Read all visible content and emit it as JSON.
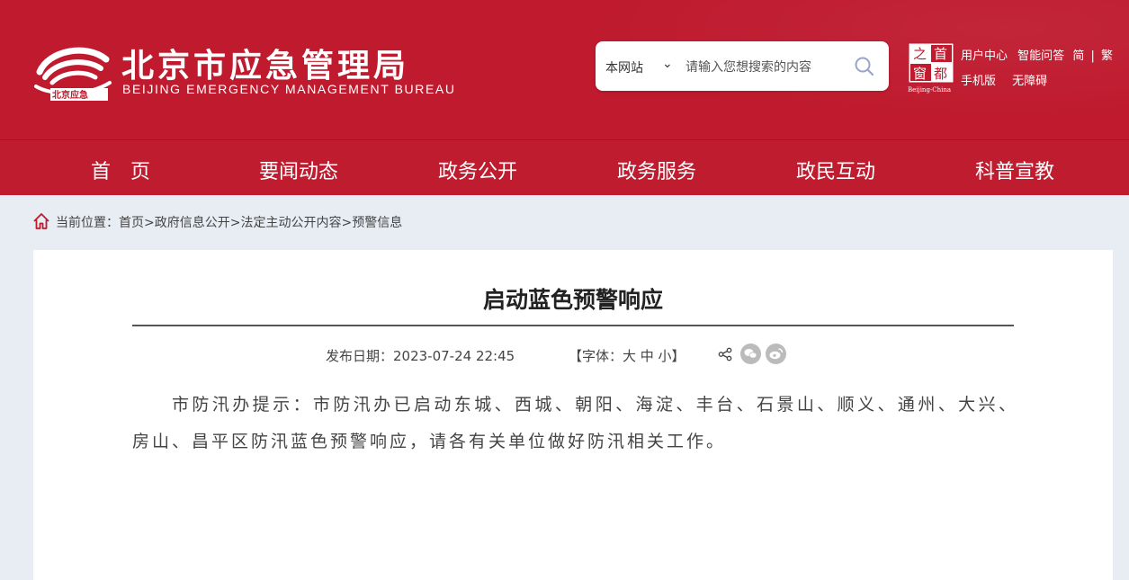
{
  "header": {
    "site_title": "北京市应急管理局",
    "site_title_en": "BEIJING EMERGENCY MANAGEMENT BUREAU",
    "logo_mark_text": "北京应急",
    "search": {
      "scope": "本网站",
      "placeholder": "请输入您想搜索的内容"
    },
    "capital_badge": {
      "chars": [
        "首",
        "都",
        "之",
        "窗"
      ],
      "caption": "Beijing-China"
    },
    "links_row1": [
      "用户中心",
      "智能问答",
      "简",
      "|",
      "繁"
    ],
    "links_row2": [
      "手机版",
      "无障碍"
    ]
  },
  "nav": {
    "items": [
      "首　页",
      "要闻动态",
      "政务公开",
      "政务服务",
      "政民互动",
      "科普宣教"
    ]
  },
  "breadcrumb": {
    "text": "当前位置：首页>政府信息公开>法定主动公开内容>预警信息"
  },
  "article": {
    "title": "启动蓝色预警响应",
    "date_label": "发布日期：2023-07-24 22:45",
    "font_label": "【字体：大 中 小】",
    "body": "市防汛办提示：市防汛办已启动东城、西城、朝阳、海淀、丰台、石景山、顺义、通州、大兴、房山、昌平区防汛蓝色预警响应，请各有关单位做好防汛相关工作。"
  },
  "icons": {
    "share": "share-icon",
    "wechat": "wechat-icon",
    "weibo": "weibo-icon",
    "search": "search-icon",
    "home": "home-icon"
  },
  "colors": {
    "brand_red": "#bf1a2e",
    "nav_red": "#c01c30",
    "page_bg": "#e8edf3"
  }
}
